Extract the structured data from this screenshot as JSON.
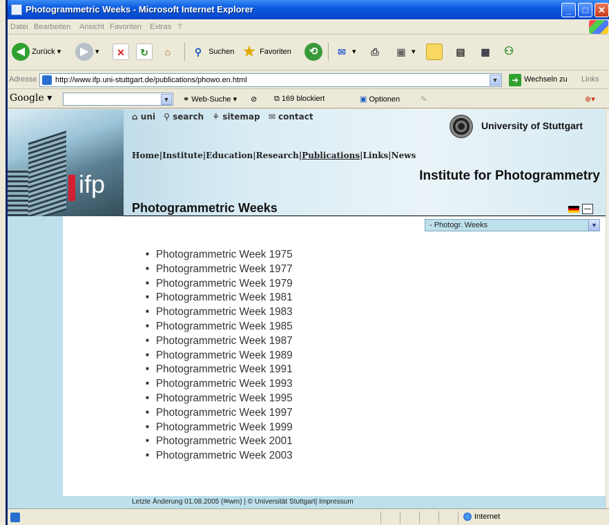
{
  "window": {
    "title": "Photogrammetric Weeks - Microsoft Internet Explorer"
  },
  "menu": [
    "Datei",
    "Bearbeiten",
    "Ansicht",
    "Favoriten",
    "Extras",
    "?"
  ],
  "toolbar": {
    "back": "Zurück",
    "search": "Suchen",
    "favorites": "Favoriten"
  },
  "address": {
    "label": "Adresse",
    "url": "http://www.ifp.uni-stuttgart.de/publications/phowo.en.html",
    "go": "Wechseln zu",
    "links": "Links"
  },
  "google": {
    "logo": "Google",
    "websearch": "Web-Suche",
    "blocked": "169 blockiert",
    "options": "Optionen"
  },
  "site": {
    "topnav": [
      "uni",
      "search",
      "sitemap",
      "contact"
    ],
    "university": "University of Stuttgart",
    "logo_text": "ifp",
    "mainnav": [
      "Home",
      "Institute",
      "Education",
      "Research",
      "Publications",
      "Links",
      "News"
    ],
    "mainnav_current": "Publications",
    "institute": "Institute for Photogrammetry",
    "page_title": "Photogrammetric Weeks",
    "select_value": "- Photogr. Weeks",
    "weeks": [
      "Photogrammetric Week 1975",
      "Photogrammetric Week 1977",
      "Photogrammetric Week 1979",
      "Photogrammetric Week 1981",
      "Photogrammetric Week 1983",
      "Photogrammetric Week 1985",
      "Photogrammetric Week 1987",
      "Photogrammetric Week 1989",
      "Photogrammetric Week 1991",
      "Photogrammetric Week 1993",
      "Photogrammetric Week 1995",
      "Photogrammetric Week 1997",
      "Photogrammetric Week 1999",
      "Photogrammetric Week 2001",
      "Photogrammetric Week 2003"
    ],
    "footer": "Letzte Änderung 01.08.2005 (✉wm) | © Universität Stuttgart| Impressum"
  },
  "status": {
    "zone": "Internet"
  },
  "colors": {
    "header_blue": "#bde0ec",
    "ifp_red": "#d22030",
    "titlebar": "#0a5ae0"
  }
}
